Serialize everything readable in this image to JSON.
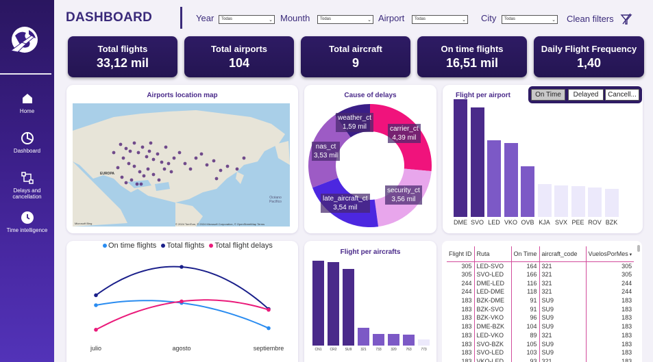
{
  "header": {
    "title": "DASHBOARD",
    "filters": [
      {
        "label": "Year",
        "value": "Todas"
      },
      {
        "label": "Mounth",
        "value": "Todas"
      },
      {
        "label": "Airport",
        "value": "Todas"
      },
      {
        "label": "City",
        "value": "Todas"
      }
    ],
    "clean_label": "Clean filters"
  },
  "sidebar": {
    "items": [
      {
        "label": "Home",
        "icon": "home-icon"
      },
      {
        "label": "Dashboard",
        "icon": "pie-chart-icon"
      },
      {
        "label": "Delays and cancellation",
        "icon": "flow-icon"
      },
      {
        "label": "Time intelligence",
        "icon": "clock-icon"
      }
    ]
  },
  "kpis": [
    {
      "label": "Total flights",
      "value": "33,12 mil"
    },
    {
      "label": "Total airports",
      "value": "104"
    },
    {
      "label": "Total aircraft",
      "value": "9"
    },
    {
      "label": "On time flights",
      "value": "16,51 mil"
    },
    {
      "label": "Daily Flight Frequency",
      "value": "1,40"
    }
  ],
  "map_panel": {
    "title": "Airports location map",
    "region_label": "EUROPA",
    "ocean_label": "Océano Pacífico",
    "copyright": "© 2024 TomTom, © 2024 Microsoft Corporation, © OpenStreetMap Terms",
    "provider": "Microsoft Bing"
  },
  "delays_panel": {
    "title": "Cause of delays",
    "colors": {
      "carrier": "#f0137c",
      "security": "#e8a6ec",
      "late_aircraft": "#4c27e0",
      "nas": "#9d5bc5",
      "weather": "#3a1e86"
    }
  },
  "airport_panel": {
    "title": "Flight per airport",
    "toggle": [
      "On Time",
      "Delayed",
      "Cancell..."
    ],
    "active_toggle": "On Time"
  },
  "trend_panel": {
    "legend": [
      {
        "name": "On time flights",
        "color": "#2a8cf0"
      },
      {
        "name": "Total flights",
        "color": "#1a1f8a"
      },
      {
        "name": "Total flight delays",
        "color": "#ea1a7a"
      }
    ]
  },
  "aircraft_panel": {
    "title": "Flight per aircrafts"
  },
  "chart_data": [
    {
      "type": "pie",
      "title": "Cause of delays",
      "categories": [
        "carrier_ct",
        "security_ct",
        "late_aircraft_ct",
        "nas_ct",
        "weather_ct"
      ],
      "values": [
        4.39,
        3.56,
        3.54,
        3.53,
        1.59
      ],
      "labels": [
        "4,39 mil",
        "3,56 mil",
        "3,54 mil",
        "3,53 mil",
        "1,59 mil"
      ]
    },
    {
      "type": "bar",
      "title": "Flight per airport",
      "categories": [
        "DME",
        "SVO",
        "LED",
        "VKO",
        "OVB",
        "KJA",
        "SVX",
        "PEE",
        "ROV",
        "BZK"
      ],
      "values": [
        100,
        93,
        65,
        63,
        43,
        28,
        27,
        26,
        25,
        24
      ]
    },
    {
      "type": "line",
      "x": [
        "julio",
        "agosto",
        "septiembre"
      ],
      "series": [
        {
          "name": "On time flights",
          "values": [
            50,
            53,
            20
          ]
        },
        {
          "name": "Total flights",
          "values": [
            63,
            100,
            45
          ]
        },
        {
          "name": "Total flight delays",
          "values": [
            18,
            55,
            44
          ]
        }
      ]
    },
    {
      "type": "bar",
      "title": "Flight per aircrafts",
      "categories": [
        "CN1",
        "CR2",
        "SU9",
        "321",
        "733",
        "320",
        "763",
        "773"
      ],
      "values": [
        100,
        98,
        90,
        21,
        14,
        14,
        13,
        7
      ]
    }
  ],
  "table": {
    "columns": [
      "Flight ID",
      "Ruta",
      "On Time",
      "aircraft_code",
      "VuelosPorMes"
    ],
    "rows": [
      [
        "305",
        "LED-SVO",
        "164",
        "321",
        "305"
      ],
      [
        "305",
        "SVO-LED",
        "166",
        "321",
        "305"
      ],
      [
        "244",
        "DME-LED",
        "116",
        "321",
        "244"
      ],
      [
        "244",
        "LED-DME",
        "118",
        "321",
        "244"
      ],
      [
        "183",
        "BZK-DME",
        "91",
        "SU9",
        "183"
      ],
      [
        "183",
        "BZK-SVO",
        "91",
        "SU9",
        "183"
      ],
      [
        "183",
        "BZK-VKO",
        "96",
        "SU9",
        "183"
      ],
      [
        "183",
        "DME-BZK",
        "104",
        "SU9",
        "183"
      ],
      [
        "183",
        "LED-VKO",
        "89",
        "321",
        "183"
      ],
      [
        "183",
        "SVO-BZK",
        "105",
        "SU9",
        "183"
      ],
      [
        "183",
        "SVO-LED",
        "103",
        "SU9",
        "183"
      ],
      [
        "183",
        "VKO-LED",
        "93",
        "321",
        "183"
      ]
    ]
  }
}
